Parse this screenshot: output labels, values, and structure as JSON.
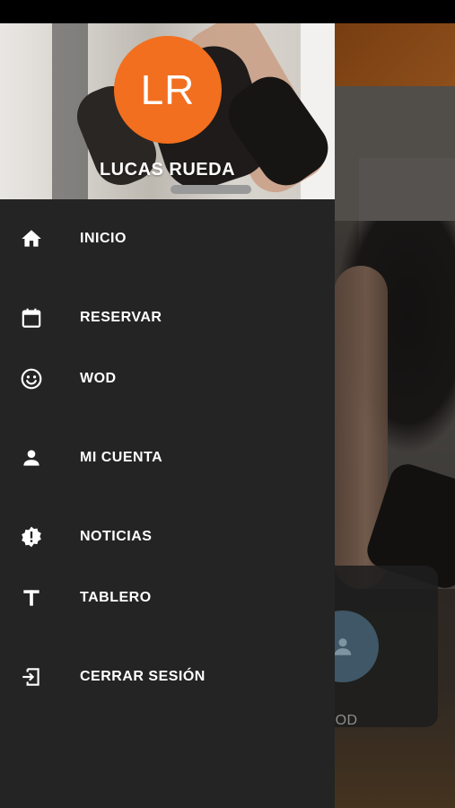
{
  "drawer": {
    "avatar_initials": "LR",
    "user_name": "LUCAS RUEDA",
    "items": [
      {
        "label": "INICIO",
        "icon": "home-icon"
      },
      {
        "label": "RESERVAR",
        "icon": "calendar-icon"
      },
      {
        "label": "WOD",
        "icon": "smiley-icon"
      },
      {
        "label": "MI CUENTA",
        "icon": "person-icon"
      },
      {
        "label": "NOTICIAS",
        "icon": "alert-badge-icon"
      },
      {
        "label": "TABLERO",
        "icon": "text-t-icon"
      },
      {
        "label": "CERRAR SESIÓN",
        "icon": "logout-icon"
      }
    ]
  },
  "background": {
    "card_label": "WOD"
  },
  "colors": {
    "accent": "#f26f1f",
    "drawer_bg": "#242424"
  }
}
